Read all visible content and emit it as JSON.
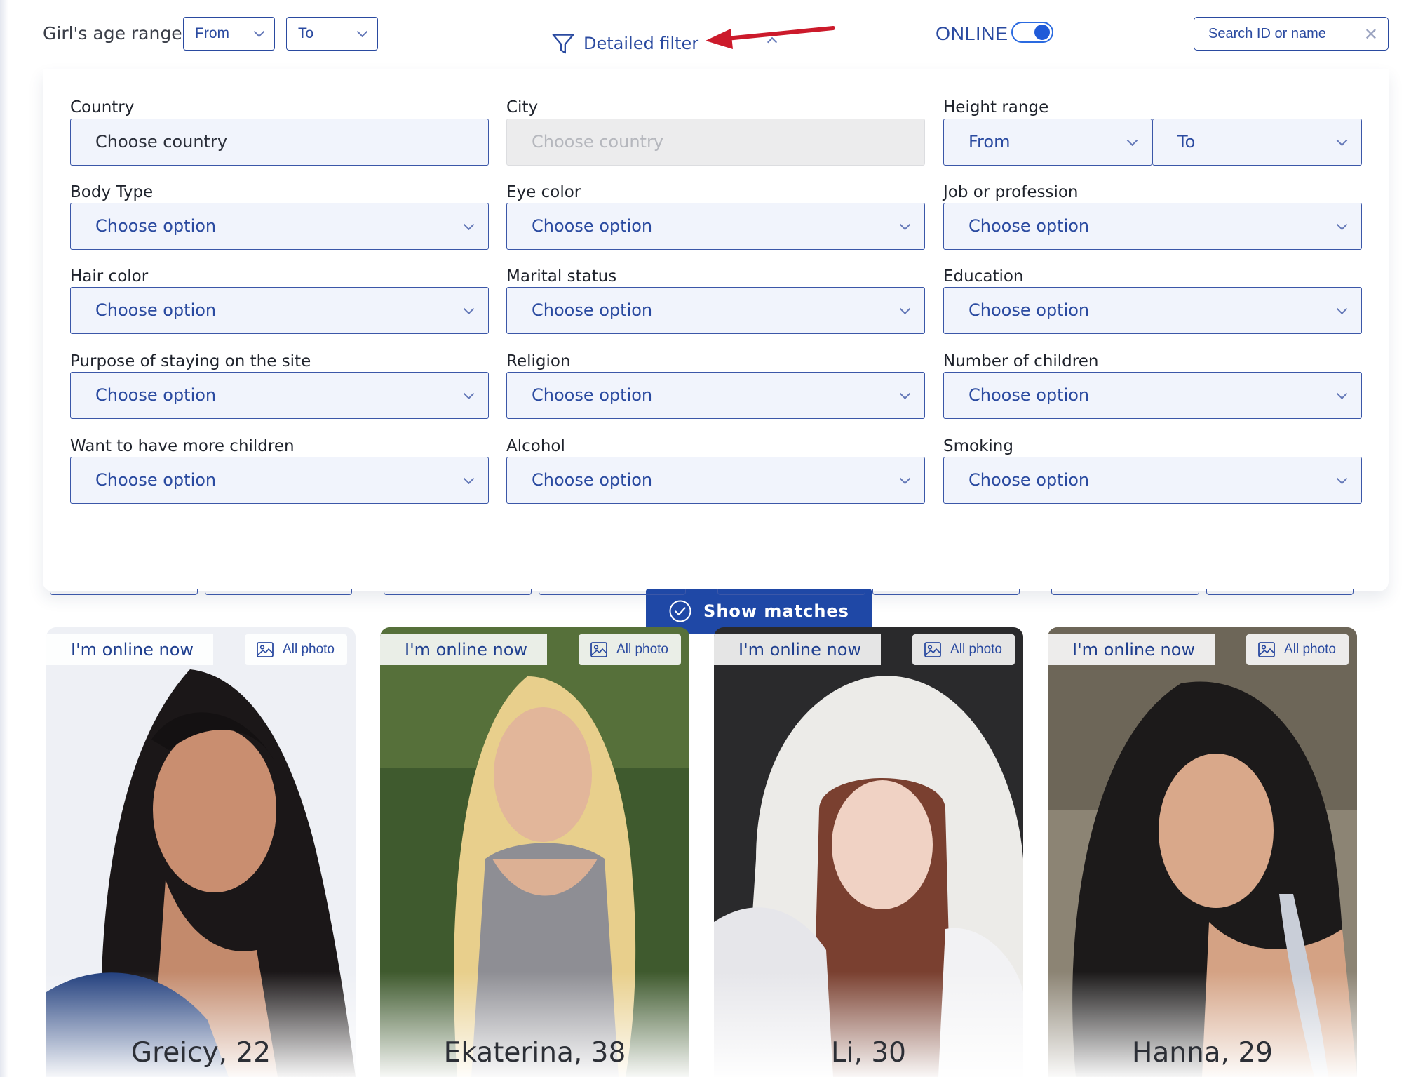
{
  "top_bar": {
    "age_label": "Girl's age range",
    "age_from": "From",
    "age_to": "To",
    "detailed_filter": "Detailed filter",
    "online_label": "ONLINE",
    "online_toggle_on": true,
    "search_placeholder": "Search ID or name"
  },
  "filter": {
    "country_label": "Country",
    "country_value": "Choose country",
    "city_label": "City",
    "city_value": "Choose country",
    "height_label": "Height range",
    "height_from": "From",
    "height_to": "To",
    "rows": [
      [
        "Body Type",
        "Eye color",
        "Job or profession"
      ],
      [
        "Hair color",
        "Marital status",
        "Education"
      ],
      [
        "Purpose of staying on the site",
        "Religion",
        "Number of children"
      ],
      [
        "Want to have more children",
        "Alcohol",
        "Smoking"
      ]
    ],
    "option_placeholder": "Choose option",
    "show_button": "Show matches"
  },
  "cards": [
    {
      "online": "I'm online now",
      "all_photo": "All photo",
      "name": "Greicy, 22"
    },
    {
      "online": "I'm online now",
      "all_photo": "All photo",
      "name": "Ekaterina, 38"
    },
    {
      "online": "I'm online now",
      "all_photo": "All photo",
      "name": "Li, 30"
    },
    {
      "online": "I'm online now",
      "all_photo": "All photo",
      "name": "Hanna, 29"
    }
  ],
  "colors": {
    "accent": "#2a4aa0",
    "button": "#1f48a6",
    "annotation_arrow": "#cc1a2b",
    "select_bg": "#f1f4fc"
  }
}
